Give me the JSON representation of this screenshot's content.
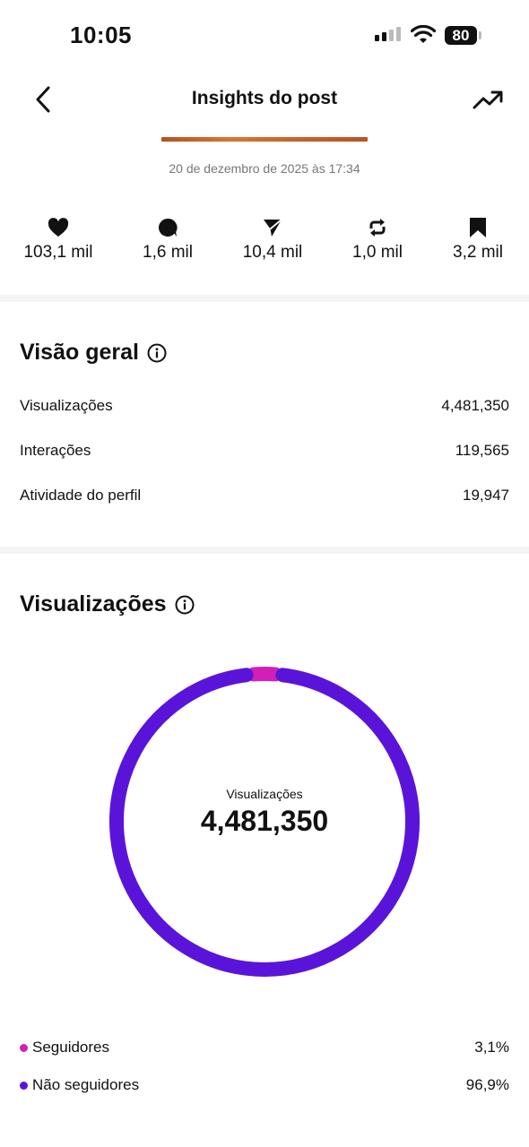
{
  "status_bar": {
    "time": "10:05",
    "battery": "80"
  },
  "header": {
    "title": "Insights do post"
  },
  "post": {
    "date": "20 de dezembro de 2025 às 17:34"
  },
  "stats": [
    {
      "icon": "heart-icon",
      "value": "103,1 mil"
    },
    {
      "icon": "comment-icon",
      "value": "1,6 mil"
    },
    {
      "icon": "send-icon",
      "value": "10,4 mil"
    },
    {
      "icon": "repost-icon",
      "value": "1,0 mil"
    },
    {
      "icon": "bookmark-icon",
      "value": "3,2 mil"
    }
  ],
  "overview": {
    "title": "Visão geral",
    "rows": [
      {
        "label": "Visualizações",
        "value": "4,481,350"
      },
      {
        "label": "Interações",
        "value": "119,565"
      },
      {
        "label": "Atividade do perfil",
        "value": "19,947"
      }
    ]
  },
  "views": {
    "title": "Visualizações",
    "center_label": "Visualizações",
    "center_value": "4,481,350",
    "legend": [
      {
        "label": "Seguidores",
        "value": "3,1%",
        "color": "#d21fb8"
      },
      {
        "label": "Não seguidores",
        "value": "96,9%",
        "color": "#5a14d9"
      }
    ]
  },
  "chart_data": {
    "type": "pie",
    "categories": [
      "Seguidores",
      "Não seguidores"
    ],
    "values": [
      3.1,
      96.9
    ],
    "colors": [
      "#d21fb8",
      "#5a14d9"
    ],
    "title": "Visualizações"
  }
}
